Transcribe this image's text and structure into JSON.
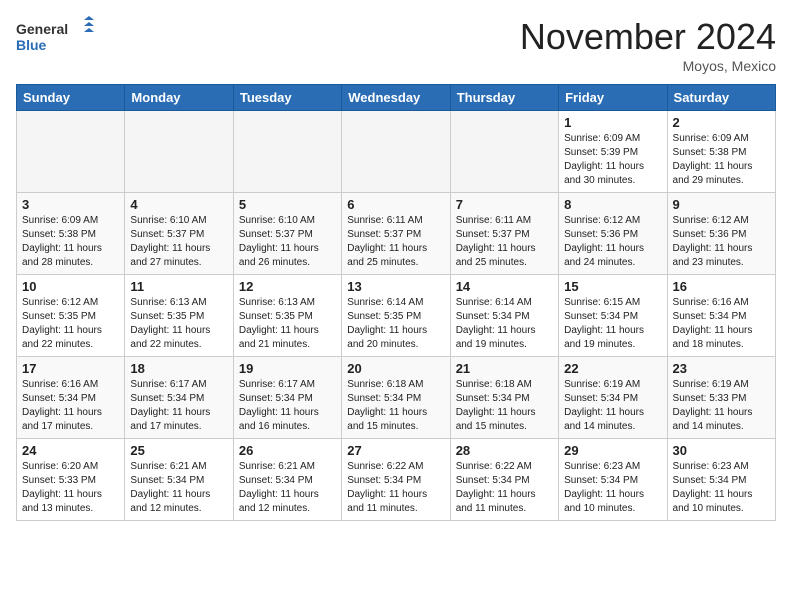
{
  "header": {
    "logo_general": "General",
    "logo_blue": "Blue",
    "month_title": "November 2024",
    "location": "Moyos, Mexico"
  },
  "weekdays": [
    "Sunday",
    "Monday",
    "Tuesday",
    "Wednesday",
    "Thursday",
    "Friday",
    "Saturday"
  ],
  "weeks": [
    [
      {
        "day": "",
        "empty": true
      },
      {
        "day": "",
        "empty": true
      },
      {
        "day": "",
        "empty": true
      },
      {
        "day": "",
        "empty": true
      },
      {
        "day": "",
        "empty": true
      },
      {
        "day": "1",
        "sunrise": "6:09 AM",
        "sunset": "5:39 PM",
        "daylight": "11 hours and 30 minutes."
      },
      {
        "day": "2",
        "sunrise": "6:09 AM",
        "sunset": "5:38 PM",
        "daylight": "11 hours and 29 minutes."
      }
    ],
    [
      {
        "day": "3",
        "sunrise": "6:09 AM",
        "sunset": "5:38 PM",
        "daylight": "11 hours and 28 minutes."
      },
      {
        "day": "4",
        "sunrise": "6:10 AM",
        "sunset": "5:37 PM",
        "daylight": "11 hours and 27 minutes."
      },
      {
        "day": "5",
        "sunrise": "6:10 AM",
        "sunset": "5:37 PM",
        "daylight": "11 hours and 26 minutes."
      },
      {
        "day": "6",
        "sunrise": "6:11 AM",
        "sunset": "5:37 PM",
        "daylight": "11 hours and 25 minutes."
      },
      {
        "day": "7",
        "sunrise": "6:11 AM",
        "sunset": "5:37 PM",
        "daylight": "11 hours and 25 minutes."
      },
      {
        "day": "8",
        "sunrise": "6:12 AM",
        "sunset": "5:36 PM",
        "daylight": "11 hours and 24 minutes."
      },
      {
        "day": "9",
        "sunrise": "6:12 AM",
        "sunset": "5:36 PM",
        "daylight": "11 hours and 23 minutes."
      }
    ],
    [
      {
        "day": "10",
        "sunrise": "6:12 AM",
        "sunset": "5:35 PM",
        "daylight": "11 hours and 22 minutes."
      },
      {
        "day": "11",
        "sunrise": "6:13 AM",
        "sunset": "5:35 PM",
        "daylight": "11 hours and 22 minutes."
      },
      {
        "day": "12",
        "sunrise": "6:13 AM",
        "sunset": "5:35 PM",
        "daylight": "11 hours and 21 minutes."
      },
      {
        "day": "13",
        "sunrise": "6:14 AM",
        "sunset": "5:35 PM",
        "daylight": "11 hours and 20 minutes."
      },
      {
        "day": "14",
        "sunrise": "6:14 AM",
        "sunset": "5:34 PM",
        "daylight": "11 hours and 19 minutes."
      },
      {
        "day": "15",
        "sunrise": "6:15 AM",
        "sunset": "5:34 PM",
        "daylight": "11 hours and 19 minutes."
      },
      {
        "day": "16",
        "sunrise": "6:16 AM",
        "sunset": "5:34 PM",
        "daylight": "11 hours and 18 minutes."
      }
    ],
    [
      {
        "day": "17",
        "sunrise": "6:16 AM",
        "sunset": "5:34 PM",
        "daylight": "11 hours and 17 minutes."
      },
      {
        "day": "18",
        "sunrise": "6:17 AM",
        "sunset": "5:34 PM",
        "daylight": "11 hours and 17 minutes."
      },
      {
        "day": "19",
        "sunrise": "6:17 AM",
        "sunset": "5:34 PM",
        "daylight": "11 hours and 16 minutes."
      },
      {
        "day": "20",
        "sunrise": "6:18 AM",
        "sunset": "5:34 PM",
        "daylight": "11 hours and 15 minutes."
      },
      {
        "day": "21",
        "sunrise": "6:18 AM",
        "sunset": "5:34 PM",
        "daylight": "11 hours and 15 minutes."
      },
      {
        "day": "22",
        "sunrise": "6:19 AM",
        "sunset": "5:34 PM",
        "daylight": "11 hours and 14 minutes."
      },
      {
        "day": "23",
        "sunrise": "6:19 AM",
        "sunset": "5:33 PM",
        "daylight": "11 hours and 14 minutes."
      }
    ],
    [
      {
        "day": "24",
        "sunrise": "6:20 AM",
        "sunset": "5:33 PM",
        "daylight": "11 hours and 13 minutes."
      },
      {
        "day": "25",
        "sunrise": "6:21 AM",
        "sunset": "5:34 PM",
        "daylight": "11 hours and 12 minutes."
      },
      {
        "day": "26",
        "sunrise": "6:21 AM",
        "sunset": "5:34 PM",
        "daylight": "11 hours and 12 minutes."
      },
      {
        "day": "27",
        "sunrise": "6:22 AM",
        "sunset": "5:34 PM",
        "daylight": "11 hours and 11 minutes."
      },
      {
        "day": "28",
        "sunrise": "6:22 AM",
        "sunset": "5:34 PM",
        "daylight": "11 hours and 11 minutes."
      },
      {
        "day": "29",
        "sunrise": "6:23 AM",
        "sunset": "5:34 PM",
        "daylight": "11 hours and 10 minutes."
      },
      {
        "day": "30",
        "sunrise": "6:23 AM",
        "sunset": "5:34 PM",
        "daylight": "11 hours and 10 minutes."
      }
    ]
  ]
}
